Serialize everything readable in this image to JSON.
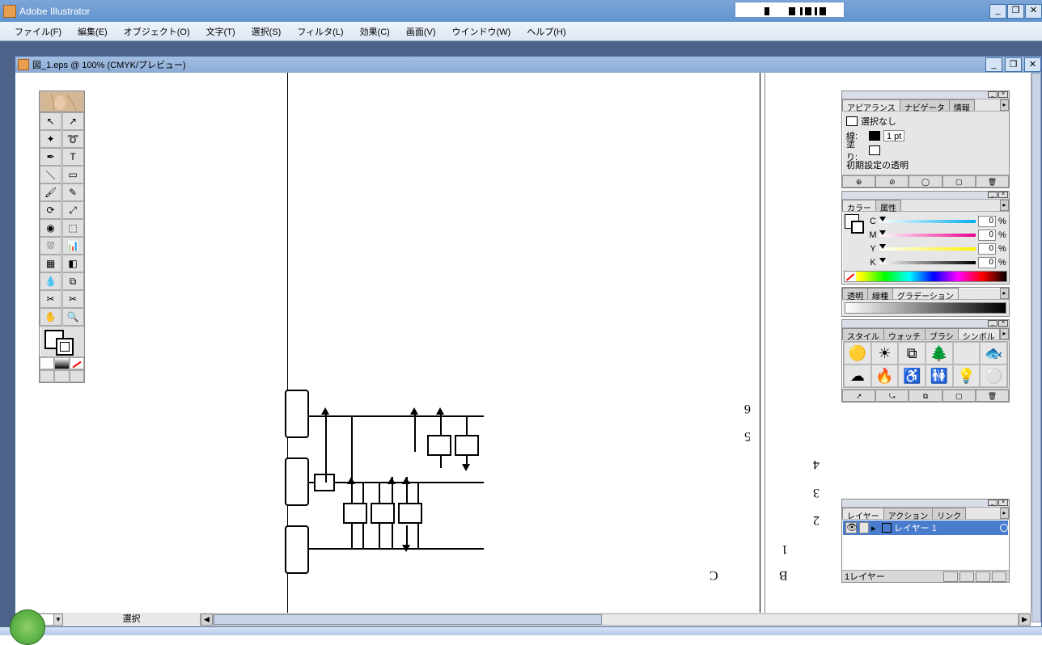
{
  "app": {
    "title": "Adobe Illustrator"
  },
  "menu": {
    "file": "ファイル(F)",
    "edit": "編集(E)",
    "object": "オブジェクト(O)",
    "type": "文字(T)",
    "select": "選択(S)",
    "filter": "フィルタ(L)",
    "effect": "効果(C)",
    "view": "画面(V)",
    "window": "ウインドウ(W)",
    "help": "ヘルプ(H)"
  },
  "doc": {
    "title": "図_1.eps @ 100% (CMYK/プレビュー)",
    "zoom": "100%",
    "status": "選択"
  },
  "appearance": {
    "tabs": [
      "アピアランス",
      "ナビゲータ",
      "情報"
    ],
    "noselection": "選択なし",
    "stroke_label": "線:",
    "stroke_value": "1 pt",
    "fill_label": "塗り:",
    "default_label": "初期設定の透明"
  },
  "color": {
    "tabs": [
      "カラー",
      "属性"
    ],
    "channels": [
      {
        "l": "C",
        "v": "0",
        "bar": "linear-gradient(90deg,#fff,#00aeef)"
      },
      {
        "l": "M",
        "v": "0",
        "bar": "linear-gradient(90deg,#fff,#ec008c)"
      },
      {
        "l": "Y",
        "v": "0",
        "bar": "linear-gradient(90deg,#fff,#fff200)"
      },
      {
        "l": "K",
        "v": "0",
        "bar": "linear-gradient(90deg,#fff,#000)"
      }
    ],
    "pct": "%"
  },
  "trans": {
    "tabs": [
      "透明",
      "線種",
      "グラデーション"
    ]
  },
  "styles": {
    "tabs": [
      "スタイル",
      "ウォッチ",
      "ブラシ",
      "シンボル"
    ]
  },
  "layers": {
    "tabs": [
      "レイヤー",
      "アクション",
      "リンク"
    ],
    "item": "レイヤー 1",
    "count": "1レイヤー"
  },
  "canvas_labels": {
    "c": "C",
    "b": "B",
    "n1": "1",
    "n2": "2",
    "n3": "3",
    "n4": "4",
    "n5": "5",
    "n6": "6"
  },
  "symbols": [
    "🟡",
    "☀",
    "⧉",
    "🌲",
    "",
    "🐟",
    "☁",
    "🔥",
    "♿",
    "🚻",
    "💡",
    "⚪"
  ]
}
